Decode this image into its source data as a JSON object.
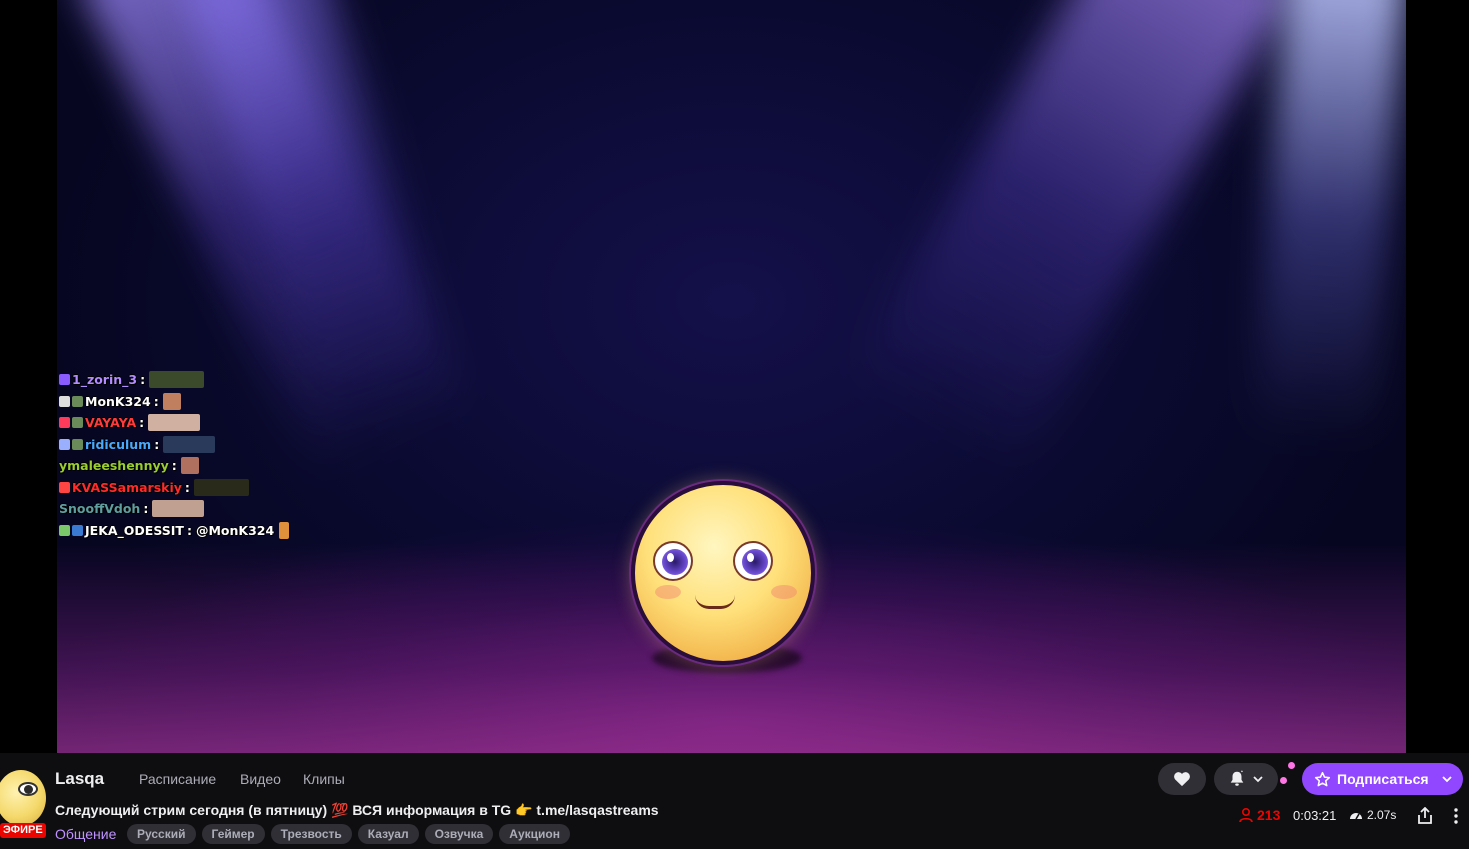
{
  "channel": {
    "name": "Lasqa",
    "live_label": "ЭФИРЕ"
  },
  "nav": {
    "schedule": "Расписание",
    "videos": "Видео",
    "clips": "Клипы"
  },
  "stream": {
    "title": "Следующий стрим сегодня (в пятницу) 💯 ВСЯ информация в TG 👉 t.me/lasqastreams",
    "category": "Общение",
    "tags": [
      "Русский",
      "Геймер",
      "Трезвость",
      "Казуал",
      "Озвучка",
      "Аукцион"
    ]
  },
  "actions": {
    "follow_icon": "heart-icon",
    "notify_icon": "bell-icon",
    "subscribe_label": "Подписаться",
    "subscribe_icon": "star-icon"
  },
  "stats": {
    "viewers": "213",
    "uptime": "0:03:21",
    "speed": "2.07s"
  },
  "chat_overlay": [
    {
      "user": "1_zorin_3",
      "color": "#b38cff",
      "message": "",
      "badges": [
        "#8a5cff"
      ]
    },
    {
      "user": "MonK324",
      "color": "#ffffff",
      "message": "",
      "badges": [
        "#dddddd",
        "#6a8a5a"
      ]
    },
    {
      "user": "VAYAYA",
      "color": "#ff3b3b",
      "message": "",
      "badges": [
        "#ff3b5c",
        "#6a8a5a"
      ]
    },
    {
      "user": "ridiculum",
      "color": "#4aa8ff",
      "message": "",
      "badges": [
        "#9ab0ff",
        "#6a8a5a"
      ]
    },
    {
      "user": "ymaleeshennyy",
      "color": "#9acd32",
      "message": "",
      "badges": []
    },
    {
      "user": "KVASSamarskiy",
      "color": "#ff2a2a",
      "message": "",
      "badges": [
        "#ff4444"
      ]
    },
    {
      "user": "SnooffVdoh",
      "color": "#5f9ea0",
      "message": "",
      "badges": []
    },
    {
      "user": "JEKA_ODESSIT",
      "color": "#ffffff",
      "message": "@MonK324",
      "badges": [
        "#7ac86a",
        "#3a7ad0"
      ]
    }
  ],
  "colors": {
    "accent": "#9147ff",
    "live": "#eb0400",
    "category": "#bf94ff"
  }
}
